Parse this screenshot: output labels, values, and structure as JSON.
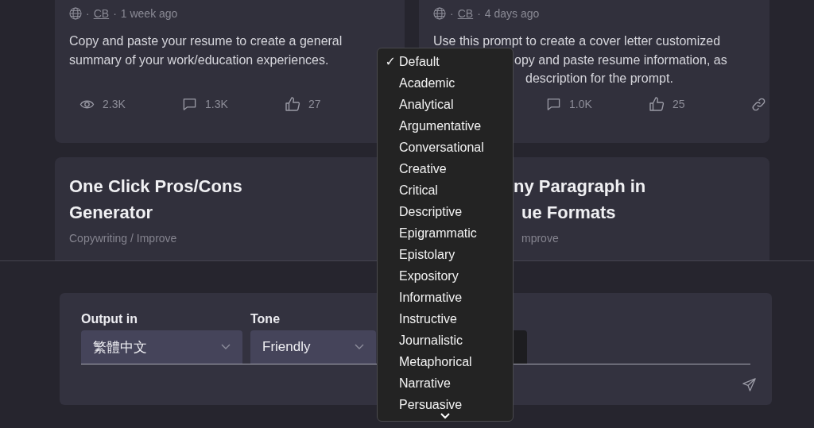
{
  "cards": [
    {
      "separator": "·",
      "author": "CB",
      "time": "1 week ago",
      "lines": [
        "Copy and paste your resume to create a general",
        "summary of your work/education experiences."
      ],
      "stats": [
        {
          "kind": "views",
          "value": "2.3K"
        },
        {
          "kind": "comments",
          "value": "1.3K"
        },
        {
          "kind": "likes",
          "value": "27"
        }
      ]
    },
    {
      "separator": "·",
      "author": "CB",
      "time": "4 days ago",
      "lines": [
        "Use this prompt to create a cover letter customized",
        "opy and paste resume information, as",
        "description for the prompt."
      ],
      "stats": [
        {
          "kind": "comments",
          "value": "1.0K"
        },
        {
          "kind": "likes",
          "value": "25"
        }
      ],
      "link": true
    }
  ],
  "cards_row2": [
    {
      "title_lines": [
        "One Click Pros/Cons",
        "Generator"
      ],
      "category": "Copywriting / Improve",
      "clipped": false
    },
    {
      "title_lines": [
        "ny Paragraph in",
        "ue Formats"
      ],
      "category": "mprove",
      "clipped": true
    }
  ],
  "panel": {
    "fields": [
      {
        "label": "Output in",
        "value": "繁體中文"
      },
      {
        "label": "Tone",
        "value": "Friendly"
      }
    ]
  },
  "dropdown": {
    "items": [
      {
        "label": "Default",
        "selected": true
      },
      {
        "label": "Academic",
        "selected": false
      },
      {
        "label": "Analytical",
        "selected": false
      },
      {
        "label": "Argumentative",
        "selected": false
      },
      {
        "label": "Conversational",
        "selected": false
      },
      {
        "label": "Creative",
        "selected": false
      },
      {
        "label": "Critical",
        "selected": false
      },
      {
        "label": "Descriptive",
        "selected": false
      },
      {
        "label": "Epigrammatic",
        "selected": false
      },
      {
        "label": "Epistolary",
        "selected": false
      },
      {
        "label": "Expository",
        "selected": false
      },
      {
        "label": "Informative",
        "selected": false
      },
      {
        "label": "Instructive",
        "selected": false
      },
      {
        "label": "Journalistic",
        "selected": false
      },
      {
        "label": "Metaphorical",
        "selected": false
      },
      {
        "label": "Narrative",
        "selected": false
      },
      {
        "label": "Persuasive",
        "selected": false
      }
    ],
    "check": "✓"
  }
}
